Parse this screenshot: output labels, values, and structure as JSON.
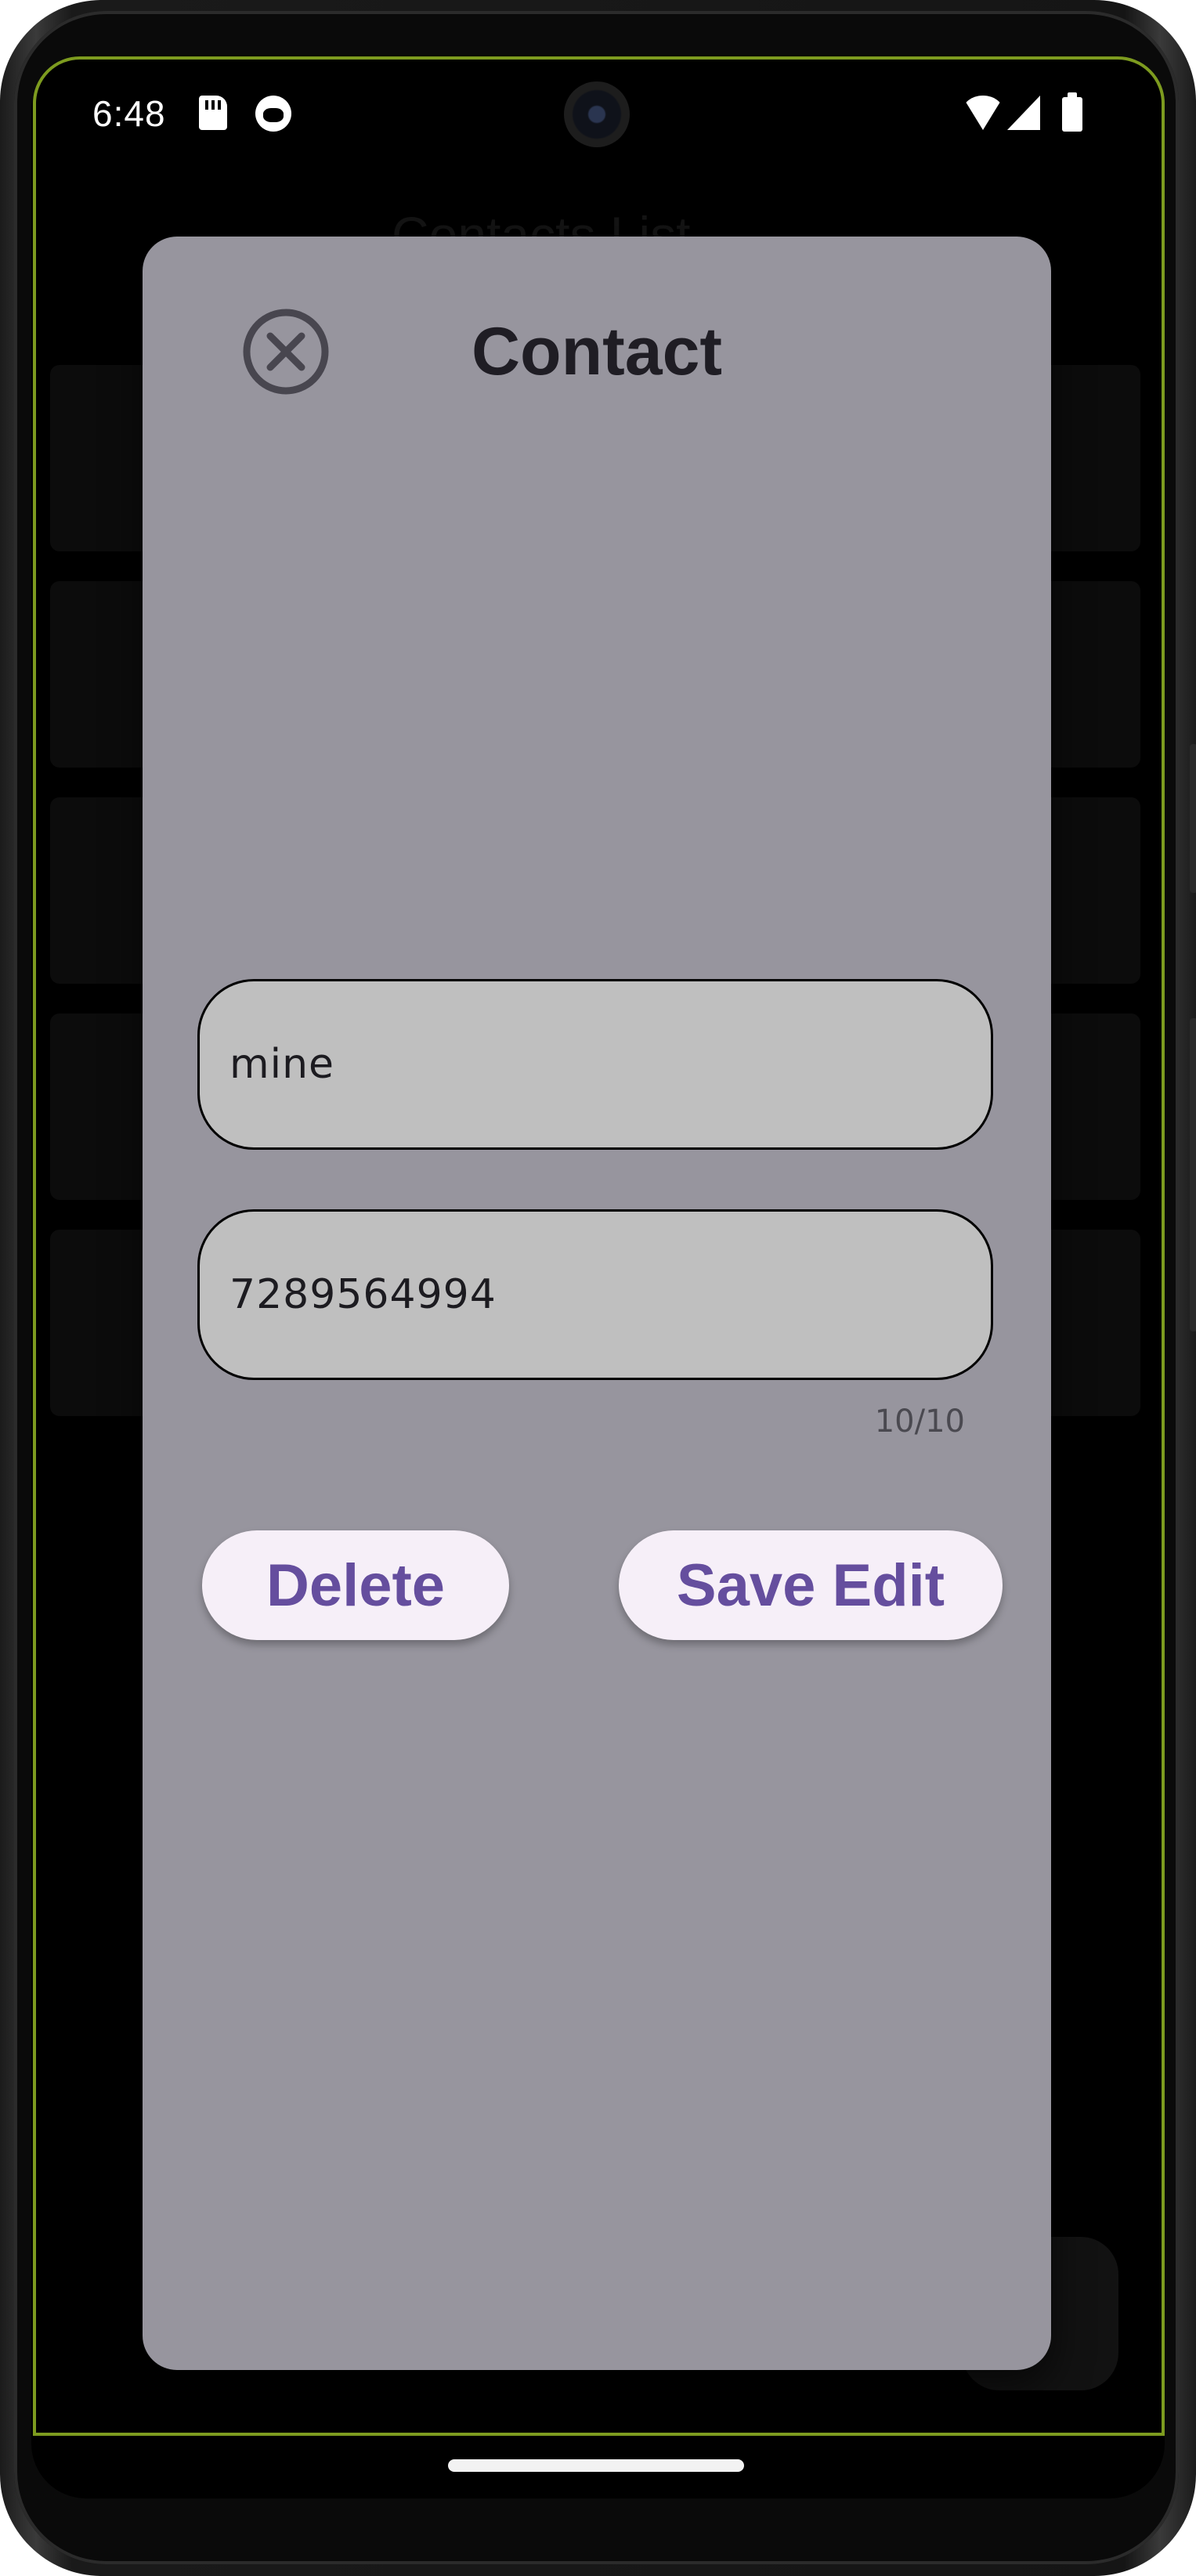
{
  "status_bar": {
    "time": "6:48",
    "icons": [
      "sd-card-icon",
      "cat-notification-icon",
      "camera-cutout",
      "wifi-icon",
      "signal-icon",
      "battery-icon"
    ]
  },
  "background_screen": {
    "title": "Contacts List"
  },
  "dialog": {
    "title": "Contact",
    "close_icon": "close-circle-icon",
    "name_field": {
      "value": "mine"
    },
    "phone_field": {
      "value": "7289564994",
      "counter": "10/10"
    },
    "buttons": {
      "delete_label": "Delete",
      "save_label": "Save Edit"
    }
  },
  "colors": {
    "dialog_background": "#97959e",
    "field_background": "#bfbfbf",
    "button_background": "#f6eff8",
    "button_text": "#654e9e",
    "title_text": "#1f1d24",
    "frame_accent": "#7d9b1f"
  }
}
